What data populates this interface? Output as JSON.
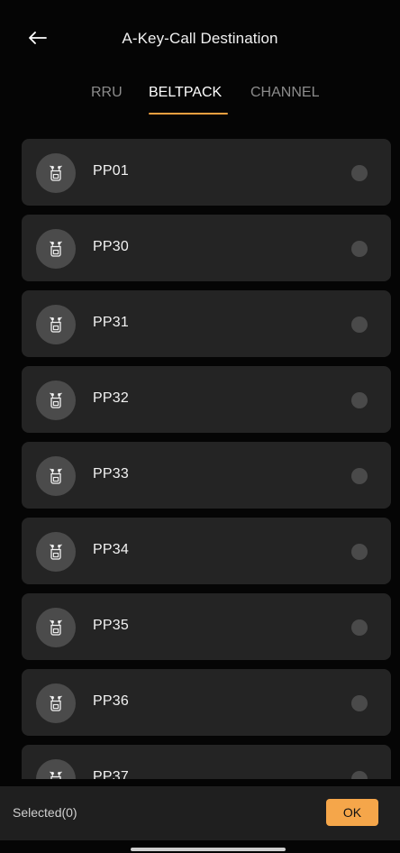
{
  "header": {
    "back_icon": "arrow-left-icon",
    "title": "A-Key-Call Destination"
  },
  "tabs": [
    {
      "label": "RRU",
      "active": false
    },
    {
      "label": "BELTPACK",
      "active": true
    },
    {
      "label": "CHANNEL",
      "active": false
    }
  ],
  "colors": {
    "accent": "#f2a040",
    "background": "#050505",
    "card": "#242424",
    "avatar": "#4b4b4b",
    "button": "#f5a64a"
  },
  "list": {
    "items": [
      {
        "label": "PP01",
        "icon": "beltpack-icon",
        "selected": false
      },
      {
        "label": "PP30",
        "icon": "beltpack-icon",
        "selected": false
      },
      {
        "label": "PP31",
        "icon": "beltpack-icon",
        "selected": false
      },
      {
        "label": "PP32",
        "icon": "beltpack-icon",
        "selected": false
      },
      {
        "label": "PP33",
        "icon": "beltpack-icon",
        "selected": false
      },
      {
        "label": "PP34",
        "icon": "beltpack-icon",
        "selected": false
      },
      {
        "label": "PP35",
        "icon": "beltpack-icon",
        "selected": false
      },
      {
        "label": "PP36",
        "icon": "beltpack-icon",
        "selected": false
      },
      {
        "label": "PP37",
        "icon": "beltpack-icon",
        "selected": false
      }
    ]
  },
  "footer": {
    "selected_text": "Selected(0)",
    "ok_label": "OK"
  }
}
